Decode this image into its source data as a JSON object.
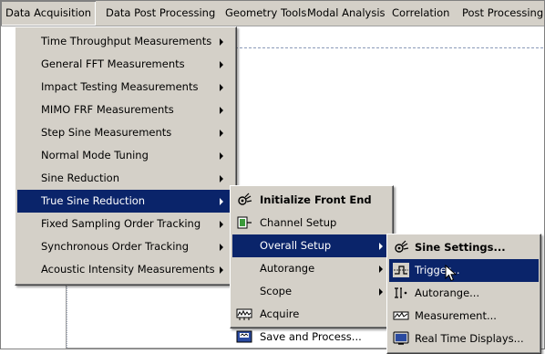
{
  "menubar": {
    "items": [
      {
        "label": "Data Acquisition"
      },
      {
        "label": "Data Post Processing"
      },
      {
        "label": "Geometry Tools"
      },
      {
        "label": "Modal Analysis"
      },
      {
        "label": "Correlation"
      },
      {
        "label": "Post Processing"
      }
    ]
  },
  "menu1": {
    "items": [
      {
        "label": "Time Throughput Measurements",
        "submenu": true
      },
      {
        "label": "General FFT Measurements",
        "submenu": true
      },
      {
        "label": "Impact Testing Measurements",
        "submenu": true
      },
      {
        "label": "MIMO FRF Measurements",
        "submenu": true
      },
      {
        "label": "Step Sine Measurements",
        "submenu": true
      },
      {
        "label": "Normal Mode Tuning",
        "submenu": true
      },
      {
        "label": "Sine Reduction",
        "submenu": true
      },
      {
        "label": "True Sine Reduction",
        "submenu": true,
        "selected": true
      },
      {
        "label": "Fixed Sampling Order Tracking",
        "submenu": true
      },
      {
        "label": "Synchronous Order Tracking",
        "submenu": true
      },
      {
        "label": "Acoustic Intensity Measurements",
        "submenu": true
      }
    ]
  },
  "menu2": {
    "items": [
      {
        "label": "Initialize Front End",
        "icon": "initialize-icon",
        "bold": true
      },
      {
        "label": "Channel Setup",
        "icon": "channel-setup-icon"
      },
      {
        "label": "Overall Setup",
        "submenu": true,
        "selected": true
      },
      {
        "label": "Autorange",
        "submenu": true
      },
      {
        "label": "Scope",
        "submenu": true
      },
      {
        "label": "Acquire",
        "icon": "acquire-icon"
      },
      {
        "label": "Save and Process...",
        "icon": "save-process-icon"
      }
    ]
  },
  "menu3": {
    "items": [
      {
        "label": "Sine Settings...",
        "icon": "sine-settings-icon",
        "bold": true
      },
      {
        "label": "Trigger...",
        "icon": "trigger-icon",
        "selected": true
      },
      {
        "label": "Autorange...",
        "icon": "autorange-icon"
      },
      {
        "label": "Measurement...",
        "icon": "measurement-icon"
      },
      {
        "label": "Real Time Displays...",
        "icon": "realtime-display-icon"
      }
    ]
  }
}
